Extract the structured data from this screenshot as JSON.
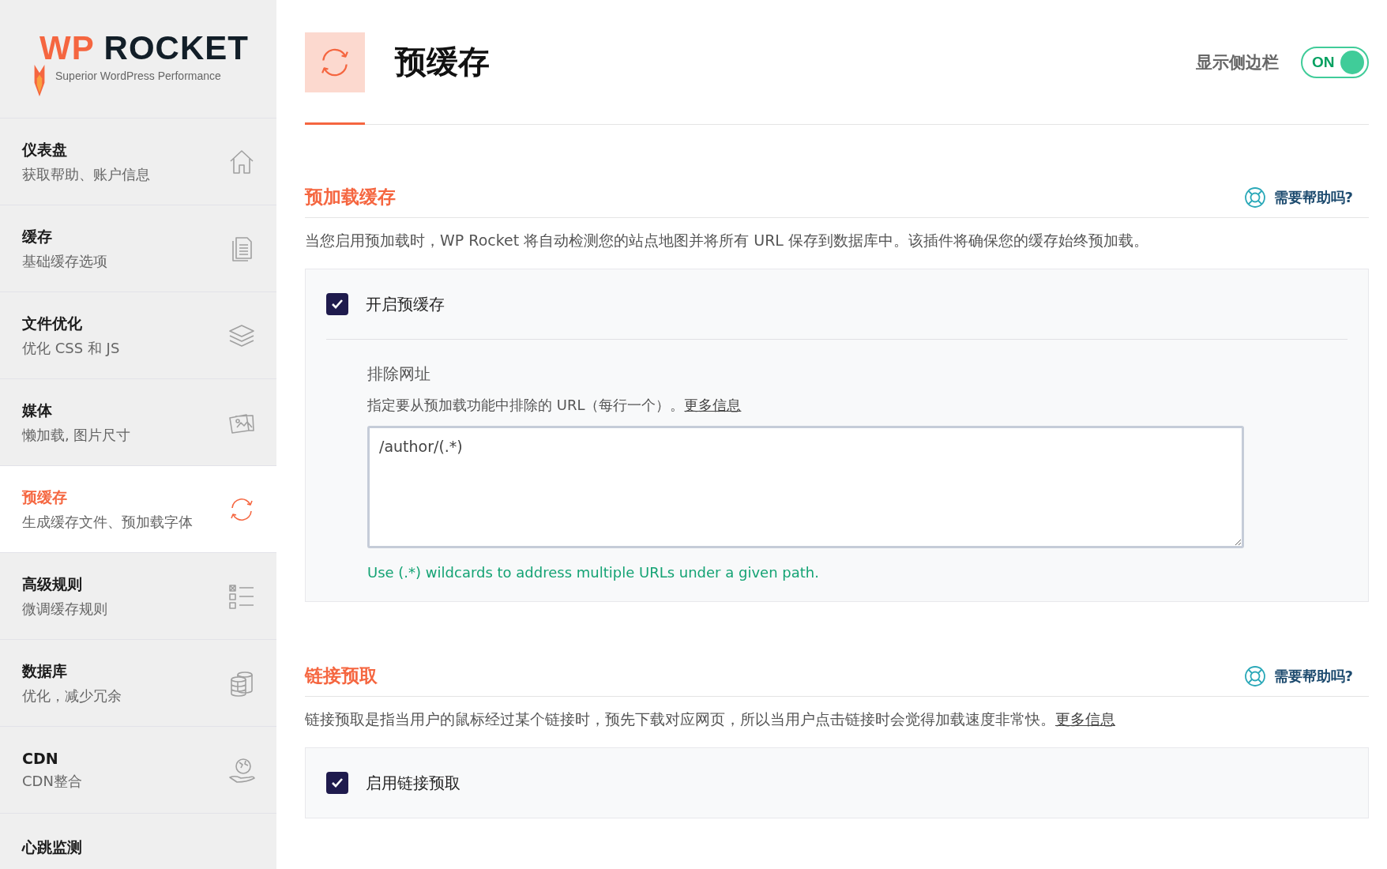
{
  "logo": {
    "brand_accent": "WP",
    "brand": "ROCKET",
    "tagline": "Superior WordPress Performance"
  },
  "sidebar": {
    "items": [
      {
        "title": "仪表盘",
        "subtitle": "获取帮助、账户信息",
        "selected": false
      },
      {
        "title": "缓存",
        "subtitle": "基础缓存选项",
        "selected": false
      },
      {
        "title": "文件优化",
        "subtitle": "优化 CSS 和 JS",
        "selected": false
      },
      {
        "title": "媒体",
        "subtitle": "懒加载, 图片尺寸",
        "selected": false
      },
      {
        "title": "预缓存",
        "subtitle": "生成缓存文件、预加载字体",
        "selected": true
      },
      {
        "title": "高级规则",
        "subtitle": "微调缓存规则",
        "selected": false
      },
      {
        "title": "数据库",
        "subtitle": "优化，减少冗余",
        "selected": false
      },
      {
        "title": "CDN",
        "subtitle": "CDN整合",
        "selected": false
      },
      {
        "title": "心跳监测",
        "selected": false
      }
    ]
  },
  "header": {
    "title": "预缓存",
    "sidebar_toggle": {
      "label": "显示侧边栏",
      "on": true,
      "state_text": "ON"
    }
  },
  "sections": [
    {
      "title": "预加载缓存",
      "help": "需要帮助吗?",
      "description": "当您启用预加载时，WP Rocket 将自动检测您的站点地图并将所有 URL 保存到数据库中。该插件将确保您的缓存始终预加载。",
      "option": {
        "label": "开启预缓存",
        "checked": true
      },
      "sub_field": {
        "label": "排除网址",
        "description": "指定要从预加载功能中排除的 URL（每行一个）。",
        "link": "更多信息",
        "value": "/author/(.*)",
        "hint": "Use (.*) wildcards to address multiple URLs under a given path."
      }
    },
    {
      "title": "链接预取",
      "help": "需要帮助吗?",
      "description": "链接预取是指当用户的鼠标经过某个链接时，预先下载对应网页，所以当用户点击链接时会觉得加载速度非常快。",
      "link": "更多信息",
      "option": {
        "label": "启用链接预取",
        "checked": true
      }
    }
  ]
}
